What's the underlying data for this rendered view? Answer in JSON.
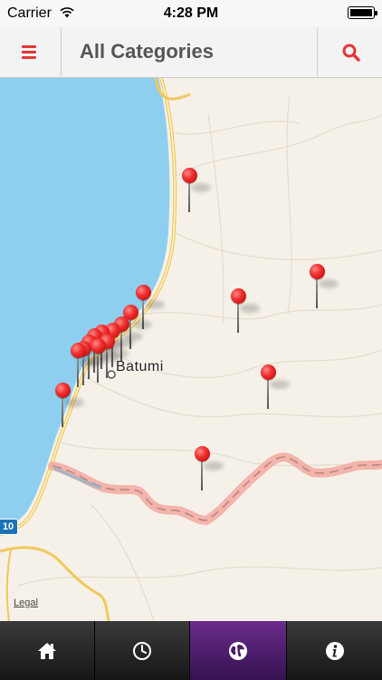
{
  "status_bar": {
    "carrier": "Carrier",
    "time": "4:28 PM"
  },
  "nav": {
    "title": "All Categories"
  },
  "map": {
    "city_label": "Batumi",
    "road_shield": "10",
    "legal": "Legal",
    "pin_count": 17
  },
  "tabs": [
    {
      "icon": "home-icon",
      "active": false
    },
    {
      "icon": "clock-icon",
      "active": false
    },
    {
      "icon": "globe-icon",
      "active": true
    },
    {
      "icon": "info-icon",
      "active": false
    }
  ],
  "colors": {
    "accent": "#e5373b",
    "active_tab": "#5a2478",
    "water": "#8ecff0",
    "land": "#f6f1e8",
    "border": "#f3a8a0"
  }
}
